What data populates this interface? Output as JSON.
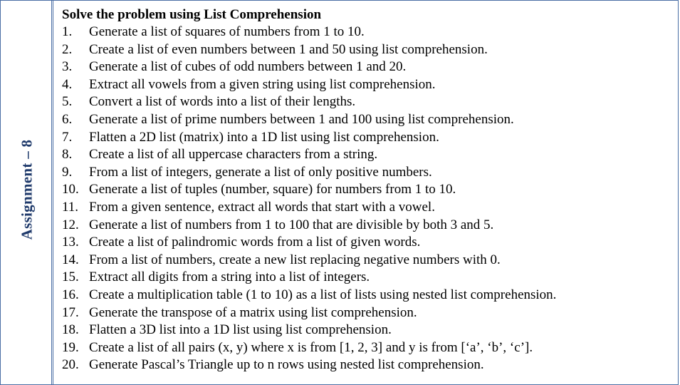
{
  "sidebar": {
    "label": "Assignment – 8"
  },
  "content": {
    "heading": "Solve the problem using List Comprehension",
    "tasks": [
      {
        "num": "1.",
        "text": "Generate a list of squares of numbers from 1 to 10."
      },
      {
        "num": "2.",
        "text": "Create a list of even numbers between 1 and 50 using list comprehension."
      },
      {
        "num": "3.",
        "text": "Generate a list of cubes of odd numbers between 1 and 20."
      },
      {
        "num": "4.",
        "text": "Extract all vowels from a given string using list comprehension."
      },
      {
        "num": "5.",
        "text": "Convert a list of words into a list of their lengths."
      },
      {
        "num": "6.",
        "text": "Generate a list of prime numbers between 1 and 100 using list comprehension."
      },
      {
        "num": "7.",
        "text": "Flatten a 2D list (matrix) into a 1D list using list comprehension."
      },
      {
        "num": "8.",
        "text": "Create a list of all uppercase characters from a string."
      },
      {
        "num": "9.",
        "text": "From a list of integers, generate a list of only positive numbers."
      },
      {
        "num": "10.",
        "text": "Generate a list of tuples (number, square) for numbers from 1 to 10."
      },
      {
        "num": "11.",
        "text": "From a given sentence, extract all words that start with a vowel."
      },
      {
        "num": "12.",
        "text": "Generate a list of numbers from 1 to 100 that are divisible by both 3 and 5."
      },
      {
        "num": "13.",
        "text": "Create a list of palindromic words from a list of given words."
      },
      {
        "num": "14.",
        "text": "From a list of numbers, create a new list replacing negative numbers with 0."
      },
      {
        "num": "15.",
        "text": "Extract all digits from a string into a list of integers."
      },
      {
        "num": "16.",
        "text": "Create a multiplication table (1 to 10) as a list of lists using nested list comprehension."
      },
      {
        "num": "17.",
        "text": "Generate the transpose of a matrix using list comprehension."
      },
      {
        "num": "18.",
        "text": "Flatten a 3D list into a 1D list using list comprehension."
      },
      {
        "num": "19.",
        "text": "Create a list of all pairs (x, y) where x is from [1, 2, 3] and y is from [‘a’, ‘b’, ‘c’]."
      },
      {
        "num": "20.",
        "text": "Generate Pascal’s Triangle up to n rows using nested list comprehension."
      }
    ]
  }
}
